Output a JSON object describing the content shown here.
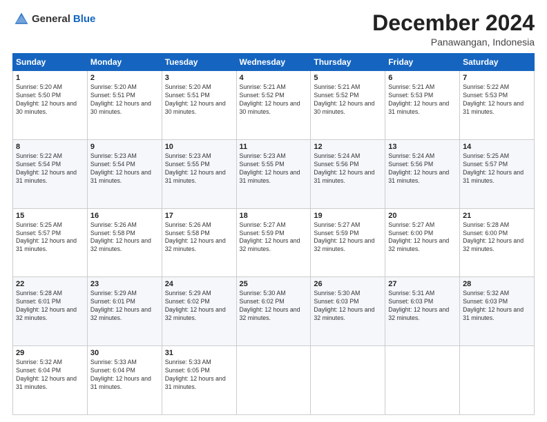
{
  "header": {
    "logo_general": "General",
    "logo_blue": "Blue",
    "title": "December 2024",
    "location": "Panawangan, Indonesia"
  },
  "days_of_week": [
    "Sunday",
    "Monday",
    "Tuesday",
    "Wednesday",
    "Thursday",
    "Friday",
    "Saturday"
  ],
  "weeks": [
    [
      {
        "day": "1",
        "sunrise": "5:20 AM",
        "sunset": "5:50 PM",
        "daylight": "12 hours and 30 minutes."
      },
      {
        "day": "2",
        "sunrise": "5:20 AM",
        "sunset": "5:51 PM",
        "daylight": "12 hours and 30 minutes."
      },
      {
        "day": "3",
        "sunrise": "5:20 AM",
        "sunset": "5:51 PM",
        "daylight": "12 hours and 30 minutes."
      },
      {
        "day": "4",
        "sunrise": "5:21 AM",
        "sunset": "5:52 PM",
        "daylight": "12 hours and 30 minutes."
      },
      {
        "day": "5",
        "sunrise": "5:21 AM",
        "sunset": "5:52 PM",
        "daylight": "12 hours and 30 minutes."
      },
      {
        "day": "6",
        "sunrise": "5:21 AM",
        "sunset": "5:53 PM",
        "daylight": "12 hours and 31 minutes."
      },
      {
        "day": "7",
        "sunrise": "5:22 AM",
        "sunset": "5:53 PM",
        "daylight": "12 hours and 31 minutes."
      }
    ],
    [
      {
        "day": "8",
        "sunrise": "5:22 AM",
        "sunset": "5:54 PM",
        "daylight": "12 hours and 31 minutes."
      },
      {
        "day": "9",
        "sunrise": "5:23 AM",
        "sunset": "5:54 PM",
        "daylight": "12 hours and 31 minutes."
      },
      {
        "day": "10",
        "sunrise": "5:23 AM",
        "sunset": "5:55 PM",
        "daylight": "12 hours and 31 minutes."
      },
      {
        "day": "11",
        "sunrise": "5:23 AM",
        "sunset": "5:55 PM",
        "daylight": "12 hours and 31 minutes."
      },
      {
        "day": "12",
        "sunrise": "5:24 AM",
        "sunset": "5:56 PM",
        "daylight": "12 hours and 31 minutes."
      },
      {
        "day": "13",
        "sunrise": "5:24 AM",
        "sunset": "5:56 PM",
        "daylight": "12 hours and 31 minutes."
      },
      {
        "day": "14",
        "sunrise": "5:25 AM",
        "sunset": "5:57 PM",
        "daylight": "12 hours and 31 minutes."
      }
    ],
    [
      {
        "day": "15",
        "sunrise": "5:25 AM",
        "sunset": "5:57 PM",
        "daylight": "12 hours and 31 minutes."
      },
      {
        "day": "16",
        "sunrise": "5:26 AM",
        "sunset": "5:58 PM",
        "daylight": "12 hours and 32 minutes."
      },
      {
        "day": "17",
        "sunrise": "5:26 AM",
        "sunset": "5:58 PM",
        "daylight": "12 hours and 32 minutes."
      },
      {
        "day": "18",
        "sunrise": "5:27 AM",
        "sunset": "5:59 PM",
        "daylight": "12 hours and 32 minutes."
      },
      {
        "day": "19",
        "sunrise": "5:27 AM",
        "sunset": "5:59 PM",
        "daylight": "12 hours and 32 minutes."
      },
      {
        "day": "20",
        "sunrise": "5:27 AM",
        "sunset": "6:00 PM",
        "daylight": "12 hours and 32 minutes."
      },
      {
        "day": "21",
        "sunrise": "5:28 AM",
        "sunset": "6:00 PM",
        "daylight": "12 hours and 32 minutes."
      }
    ],
    [
      {
        "day": "22",
        "sunrise": "5:28 AM",
        "sunset": "6:01 PM",
        "daylight": "12 hours and 32 minutes."
      },
      {
        "day": "23",
        "sunrise": "5:29 AM",
        "sunset": "6:01 PM",
        "daylight": "12 hours and 32 minutes."
      },
      {
        "day": "24",
        "sunrise": "5:29 AM",
        "sunset": "6:02 PM",
        "daylight": "12 hours and 32 minutes."
      },
      {
        "day": "25",
        "sunrise": "5:30 AM",
        "sunset": "6:02 PM",
        "daylight": "12 hours and 32 minutes."
      },
      {
        "day": "26",
        "sunrise": "5:30 AM",
        "sunset": "6:03 PM",
        "daylight": "12 hours and 32 minutes."
      },
      {
        "day": "27",
        "sunrise": "5:31 AM",
        "sunset": "6:03 PM",
        "daylight": "12 hours and 32 minutes."
      },
      {
        "day": "28",
        "sunrise": "5:32 AM",
        "sunset": "6:03 PM",
        "daylight": "12 hours and 31 minutes."
      }
    ],
    [
      {
        "day": "29",
        "sunrise": "5:32 AM",
        "sunset": "6:04 PM",
        "daylight": "12 hours and 31 minutes."
      },
      {
        "day": "30",
        "sunrise": "5:33 AM",
        "sunset": "6:04 PM",
        "daylight": "12 hours and 31 minutes."
      },
      {
        "day": "31",
        "sunrise": "5:33 AM",
        "sunset": "6:05 PM",
        "daylight": "12 hours and 31 minutes."
      },
      null,
      null,
      null,
      null
    ]
  ]
}
